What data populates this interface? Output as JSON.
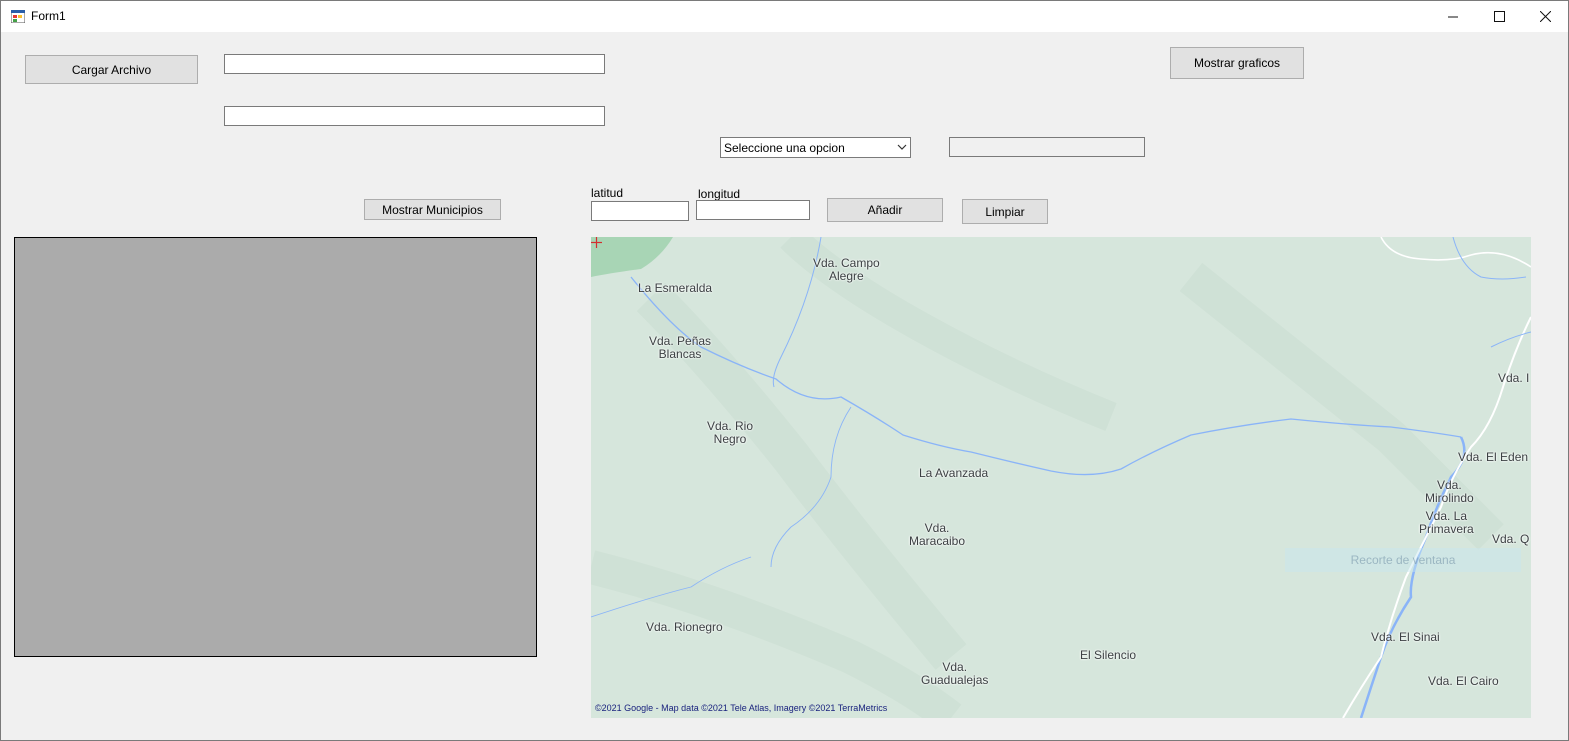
{
  "window": {
    "title": "Form1",
    "minimize_icon": "minimize-icon",
    "maximize_icon": "maximize-icon",
    "close_icon": "close-icon"
  },
  "buttons": {
    "load_file": "Cargar Archivo",
    "show_charts": "Mostrar graficos",
    "show_municipalities": "Mostrar Municipios",
    "add": "Añadir",
    "clear": "Limpiar"
  },
  "inputs": {
    "file_path": "",
    "second_field": "",
    "combo_value": "Seleccione una opcion",
    "combo_result": "",
    "latitude": "",
    "longitude": ""
  },
  "labels": {
    "latitude": "latitud",
    "longitude": "longitud"
  },
  "map": {
    "places": [
      "Vda. Campo Alegre",
      "La Esmeralda",
      "Vda. Peñas Blancas",
      "Vda. Rio Negro",
      "La Avanzada",
      "Vda. Maracaibo",
      "Vda. Rionegro",
      "El Silencio",
      "Vda. Guadualejas",
      "Vda. El Sinai",
      "Vda. El Cairo",
      "Vda. El Eden",
      "Vda. Mirolindo",
      "Vda. La Primavera",
      "Vda. Q",
      "Vda. I"
    ],
    "attribution": "©2021 Google - Map data ©2021 Tele Atlas, Imagery ©2021 TerraMetrics",
    "watermark": "Recorte de ventana",
    "colors": {
      "land": "#d6e6dc",
      "water": "#8ab4f8",
      "forest": "#a8d5b5"
    }
  }
}
